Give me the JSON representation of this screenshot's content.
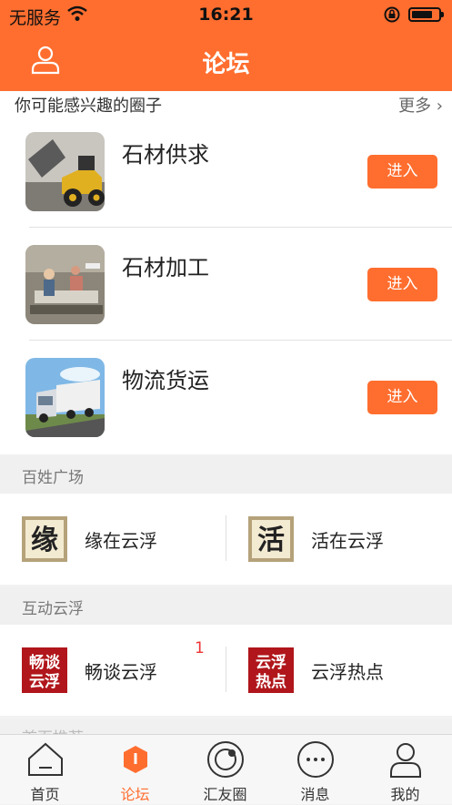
{
  "status_bar": {
    "carrier": "无服务",
    "time": "16:21"
  },
  "nav": {
    "title": "论坛"
  },
  "interest": {
    "heading": "你可能感兴趣的圈子",
    "more": "更多 ›",
    "items": [
      {
        "name": "石材供求",
        "button": "进入"
      },
      {
        "name": "石材加工",
        "button": "进入"
      },
      {
        "name": "物流货运",
        "button": "进入"
      }
    ]
  },
  "plaza": {
    "title": "百姓广场",
    "items": [
      {
        "label": "缘在云浮",
        "icon_text": "缘"
      },
      {
        "label": "活在云浮",
        "icon_text": "活"
      }
    ]
  },
  "interact": {
    "title": "互动云浮",
    "items": [
      {
        "label": "畅谈云浮",
        "icon_text_1": "畅谈",
        "icon_text_2": "云浮",
        "badge": "1"
      },
      {
        "label": "云浮热点",
        "icon_text_1": "云浮",
        "icon_text_2": "热点"
      }
    ]
  },
  "next_section": {
    "title": "首页推荐"
  },
  "tabs": [
    {
      "label": "首页",
      "icon": "home-icon"
    },
    {
      "label": "论坛",
      "icon": "forum-icon"
    },
    {
      "label": "汇友圈",
      "icon": "camera-icon"
    },
    {
      "label": "消息",
      "icon": "message-icon"
    },
    {
      "label": "我的",
      "icon": "profile-icon"
    }
  ],
  "colors": {
    "accent": "#ff6e2f",
    "badge": "#e33333",
    "seal_red": "#b0161b"
  }
}
